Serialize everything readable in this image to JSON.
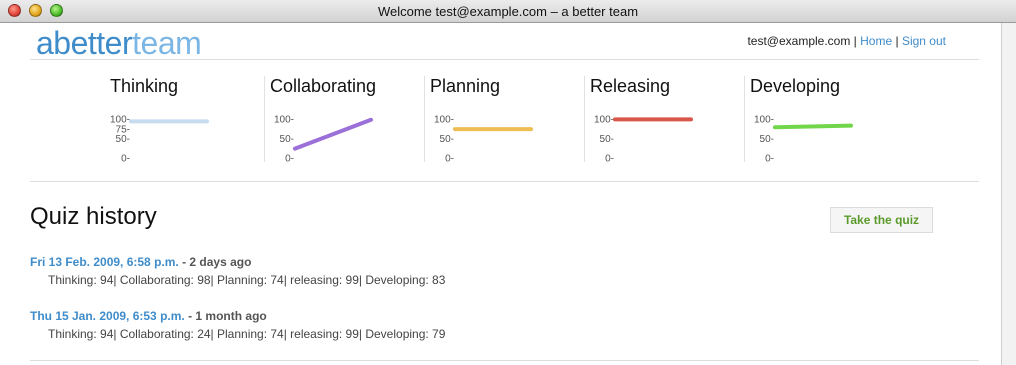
{
  "window": {
    "title": "Welcome test@example.com – a better team"
  },
  "logo": {
    "part1": "abetter",
    "part2": "team"
  },
  "user_nav": {
    "email": "test@example.com",
    "sep1": " | ",
    "home": "Home",
    "sep2": "| ",
    "signout": "Sign out"
  },
  "metrics": [
    {
      "name": "Thinking",
      "ticks": [
        "100-",
        "75-",
        "50-",
        "0-"
      ],
      "values": [
        94,
        94
      ],
      "color": "#c8dcf0"
    },
    {
      "name": "Collaborating",
      "ticks": [
        "100-",
        "50-",
        "0-"
      ],
      "values": [
        24,
        98
      ],
      "color": "#9b70d8"
    },
    {
      "name": "Planning",
      "ticks": [
        "100-",
        "50-",
        "0-"
      ],
      "values": [
        74,
        74
      ],
      "color": "#eebd52"
    },
    {
      "name": "Releasing",
      "ticks": [
        "100-",
        "50-",
        "0-"
      ],
      "values": [
        99,
        99
      ],
      "color": "#d9574a"
    },
    {
      "name": "Developing",
      "ticks": [
        "100-",
        "50-",
        "0-"
      ],
      "values": [
        79,
        83
      ],
      "color": "#72d64a"
    }
  ],
  "history": {
    "title": "Quiz history",
    "quiz_button": "Take the quiz",
    "entries": [
      {
        "date": "Fri 13 Feb. 2009, 6:58 p.m.",
        "ago": " - 2 days ago",
        "scores": "Thinking: 94| Collaborating: 98| Planning: 74| releasing: 99| Developing: 83"
      },
      {
        "date": "Thu 15 Jan. 2009, 6:53 p.m.",
        "ago": " - 1 month ago",
        "scores": "Thinking: 94| Collaborating: 24| Planning: 74| releasing: 99| Developing: 79"
      }
    ]
  }
}
